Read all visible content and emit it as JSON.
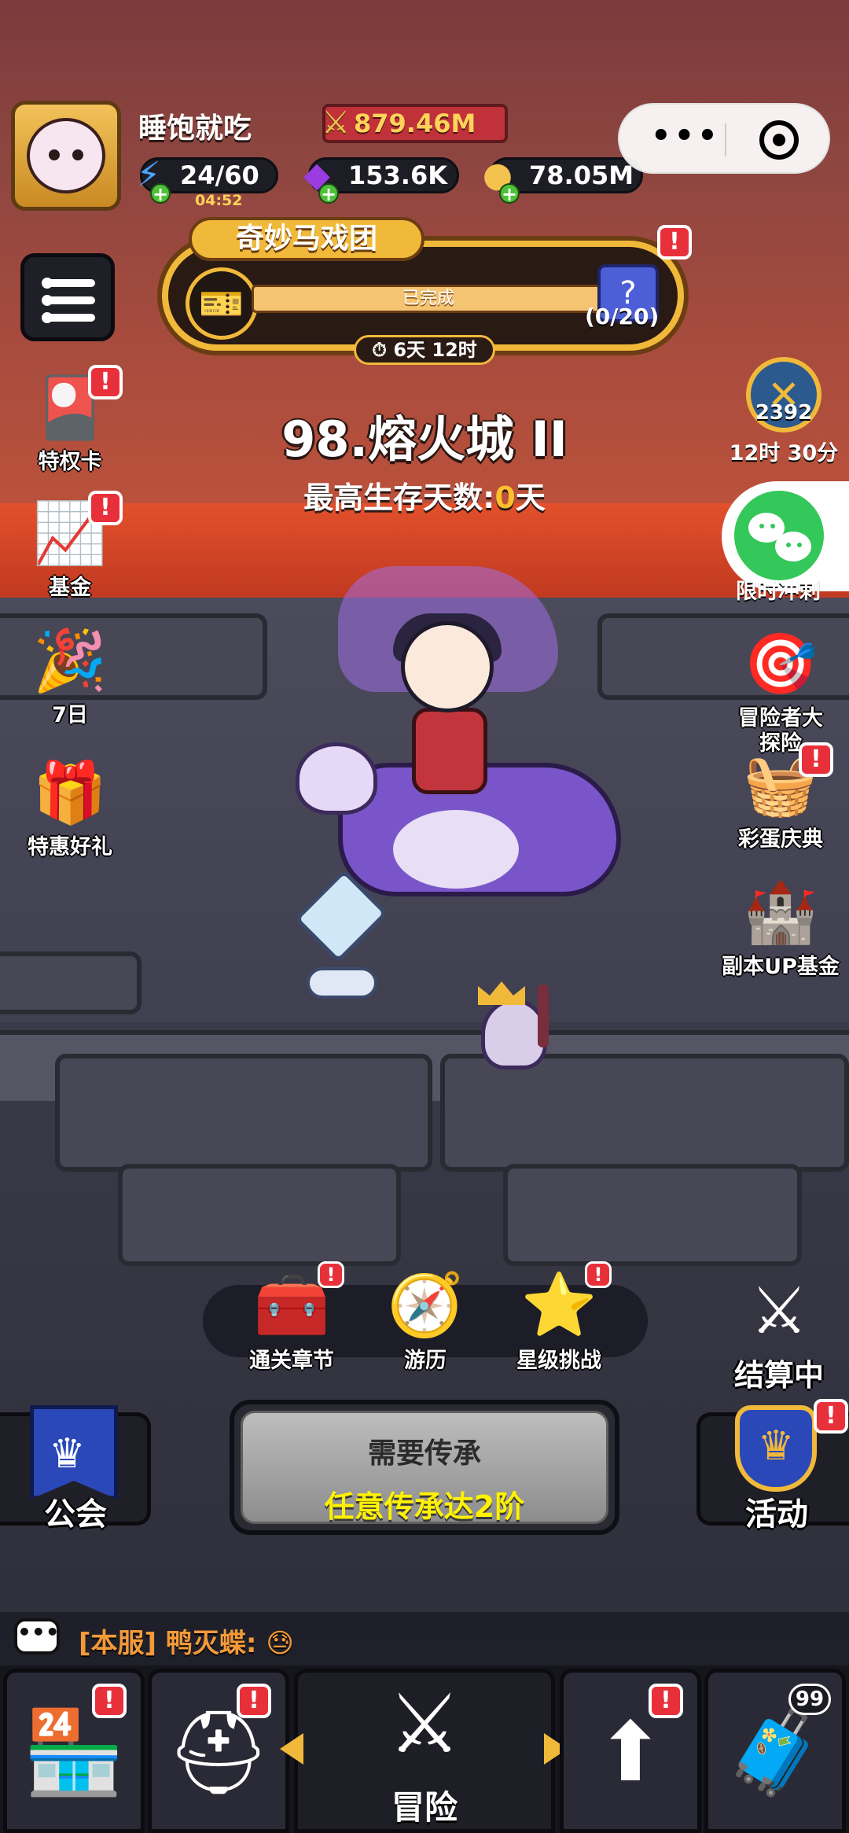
{
  "player": {
    "name": "睡饱就吃",
    "power": "879.46M"
  },
  "resources": {
    "energy": "24/60",
    "energy_timer": "04:52",
    "gems": "153.6K",
    "gold": "78.05M"
  },
  "event": {
    "title": "奇妙马戏团",
    "progress_label": "已完成",
    "progress": 1.0,
    "reward_count": "(0/20)",
    "time_left": "6天 12时"
  },
  "stage": {
    "title": "98.熔火城 II",
    "survival_prefix": "最高生存天数:",
    "survival_value": "0",
    "survival_suffix": "天"
  },
  "left_icons": [
    {
      "label": "特权卡",
      "icon": "privilege-card-icon"
    },
    {
      "label": "基金",
      "icon": "fund-chart-icon"
    },
    {
      "label": "7日",
      "icon": "seven-day-icon"
    },
    {
      "label": "特惠好礼",
      "icon": "gift-box-icon"
    }
  ],
  "right_icons": {
    "pvp_score": "2392",
    "pvp_time": "12时 30分",
    "limited_label": "限时冲刺",
    "adventure": "冒险者大探险",
    "easter": "彩蛋庆典",
    "dungeon_fund": "副本UP基金"
  },
  "chapter_buttons": [
    {
      "label": "通关章节",
      "icon": "chapter-chest-icon"
    },
    {
      "label": "游历",
      "icon": "compass-icon"
    },
    {
      "label": "星级挑战",
      "icon": "star-crown-icon"
    }
  ],
  "settle_label": "结算中",
  "guild_label": "公会",
  "activity_label": "活动",
  "quest": {
    "line1": "需要传承",
    "line2": "任意传承达2阶"
  },
  "chat": {
    "text": "[本服] 鸭灭蝶:"
  },
  "nav": {
    "center_label": "冒险",
    "chest_badge": "99",
    "alert_mark": "!"
  },
  "colors": {
    "accent_gold": "#f1b93a",
    "alert_red": "#e8303b",
    "highlight_yellow": "#fff200"
  }
}
